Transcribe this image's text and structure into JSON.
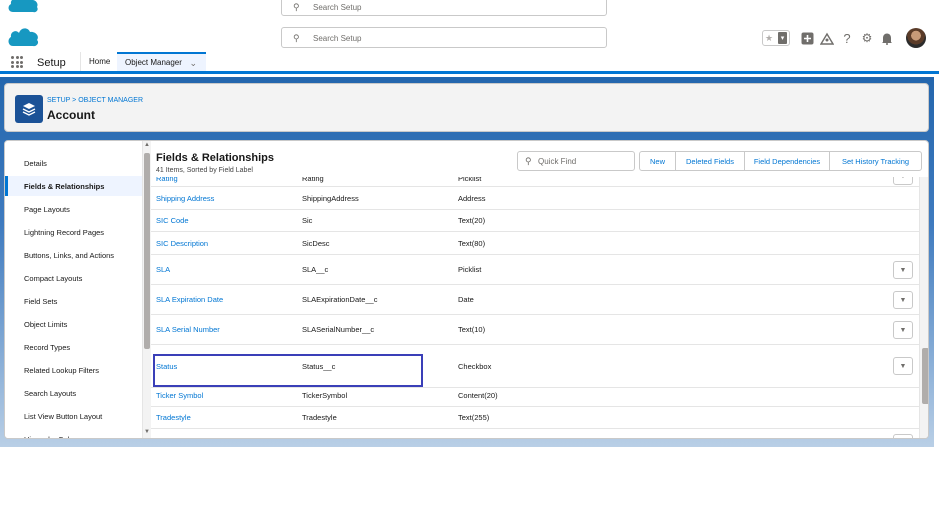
{
  "header": {
    "search_placeholder": "Search Setup",
    "ghost_search_placeholder": "Search Setup",
    "icons": [
      "star-icon",
      "chevron-down-icon",
      "plus-icon",
      "trailhead-icon",
      "help-icon",
      "gear-icon",
      "bell-icon"
    ]
  },
  "context_bar": {
    "app_name": "Setup",
    "home_label": "Home",
    "object_manager_label": "Object Manager"
  },
  "page_header": {
    "breadcrumb": "SETUP > OBJECT MANAGER",
    "title": "Account"
  },
  "sidebar": {
    "items": [
      {
        "label": "Details",
        "active": false
      },
      {
        "label": "Fields & Relationships",
        "active": true
      },
      {
        "label": "Page Layouts",
        "active": false
      },
      {
        "label": "Lightning Record Pages",
        "active": false
      },
      {
        "label": "Buttons, Links, and Actions",
        "active": false
      },
      {
        "label": "Compact Layouts",
        "active": false
      },
      {
        "label": "Field Sets",
        "active": false
      },
      {
        "label": "Object Limits",
        "active": false
      },
      {
        "label": "Record Types",
        "active": false
      },
      {
        "label": "Related Lookup Filters",
        "active": false
      },
      {
        "label": "Search Layouts",
        "active": false
      },
      {
        "label": "List View Button Layout",
        "active": false
      },
      {
        "label": "Hierarchy Columns",
        "active": false
      }
    ]
  },
  "content": {
    "title": "Fields & Relationships",
    "subtitle": "41 Items, Sorted by Field Label",
    "quick_find_placeholder": "Quick Find",
    "buttons": [
      "New",
      "Deleted Fields",
      "Field Dependencies",
      "Set History Tracking"
    ],
    "rows": [
      {
        "label": "Rating",
        "api": "Rating",
        "type": "Picklist",
        "action": true
      },
      {
        "label": "Shipping Address",
        "api": "ShippingAddress",
        "type": "Address",
        "action": false
      },
      {
        "label": "SIC Code",
        "api": "Sic",
        "type": "Text(20)",
        "action": false
      },
      {
        "label": "SIC Description",
        "api": "SicDesc",
        "type": "Text(80)",
        "action": false
      },
      {
        "label": "SLA",
        "api": "SLA__c",
        "type": "Picklist",
        "action": true
      },
      {
        "label": "SLA Expiration Date",
        "api": "SLAExpirationDate__c",
        "type": "Date",
        "action": true
      },
      {
        "label": "SLA Serial Number",
        "api": "SLASerialNumber__c",
        "type": "Text(10)",
        "action": true
      },
      {
        "label": "Status",
        "api": "Status__c",
        "type": "Checkbox",
        "action": true
      },
      {
        "label": "Ticker Symbol",
        "api": "TickerSymbol",
        "type": "Content(20)",
        "action": false
      },
      {
        "label": "Tradestyle",
        "api": "Tradestyle",
        "type": "Text(255)",
        "action": false
      },
      {
        "label": "",
        "api": "",
        "type": "",
        "action": true
      }
    ]
  },
  "colors": {
    "brand_blue": "#0176d3",
    "highlight": "#3a3fb8"
  }
}
